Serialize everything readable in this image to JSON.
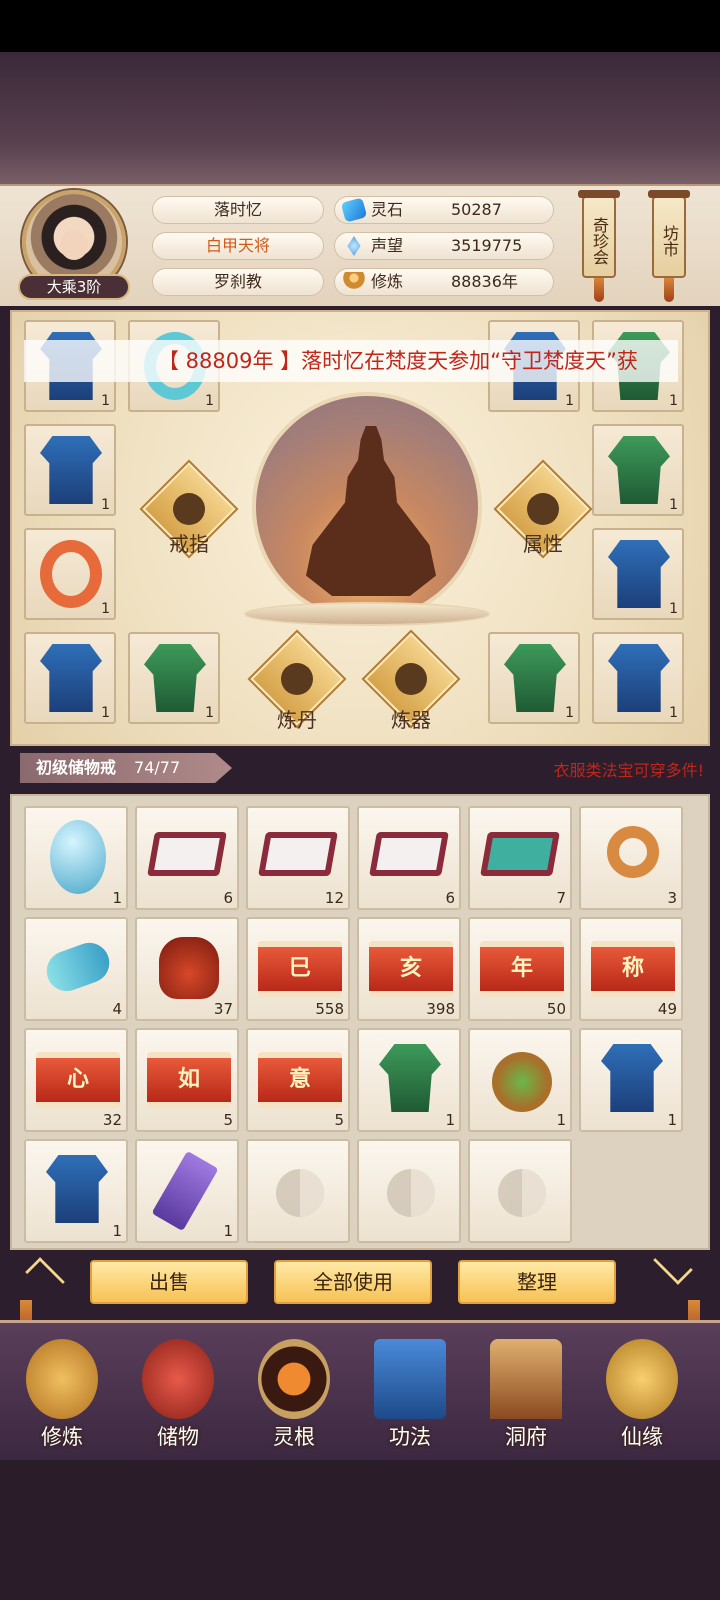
{
  "header": {
    "rank": "大乘3阶",
    "name": "落时忆",
    "title": "白甲天将",
    "sect": "罗刹教",
    "stats": [
      {
        "icon": "spirit-stone-icon",
        "label": "灵石",
        "value": "50287"
      },
      {
        "icon": "reputation-icon",
        "label": "声望",
        "value": "3519775"
      },
      {
        "icon": "cultivation-icon",
        "label": "修炼",
        "value": "88836年"
      }
    ],
    "shops": [
      "奇珍会",
      "坊市"
    ]
  },
  "ticker": "【 88809年 】落时忆在梵度天参加“守卫梵度天”获",
  "equipment": {
    "left_slots": [
      {
        "icon": "blue-armor-icon",
        "count": "1"
      },
      {
        "icon": "jade-bracelet-icon",
        "count": "1"
      },
      {
        "icon": "blue-armor-icon",
        "count": "1"
      },
      {
        "icon": "flower-ring-icon",
        "count": "1"
      },
      {
        "icon": "blue-armor-icon",
        "count": "1"
      },
      {
        "icon": "green-armor-icon",
        "count": "1"
      }
    ],
    "right_slots": [
      {
        "icon": "blue-armor-icon",
        "count": "1"
      },
      {
        "icon": "green-armor-icon",
        "count": "1"
      },
      {
        "icon": "green-armor-icon",
        "count": "1"
      },
      {
        "icon": "blue-armor-icon",
        "count": "1"
      },
      {
        "icon": "green-armor-icon",
        "count": "1"
      },
      {
        "icon": "blue-armor-icon",
        "count": "1"
      }
    ],
    "actions": {
      "ring": "戒指",
      "attributes": "属性",
      "alchemy": "炼丹",
      "forge": "炼器"
    }
  },
  "storage": {
    "name": "初级储物戒",
    "capacity": "74/77",
    "tip": "衣服类法宝可穿多件!",
    "items": [
      {
        "icon": "dragon-egg-icon",
        "count": "1"
      },
      {
        "icon": "white-rice-icon",
        "count": "6"
      },
      {
        "icon": "white-rice-icon",
        "count": "12"
      },
      {
        "icon": "white-rice-icon",
        "count": "6"
      },
      {
        "icon": "jade-leaves-icon",
        "count": "7"
      },
      {
        "icon": "gold-ring-icon",
        "count": "3"
      },
      {
        "icon": "jade-charm-icon",
        "count": "4"
      },
      {
        "icon": "teapot-icon",
        "count": "37"
      },
      {
        "icon": "scroll-icon",
        "glyph": "巳",
        "count": "558"
      },
      {
        "icon": "scroll-icon",
        "glyph": "亥",
        "count": "398"
      },
      {
        "icon": "scroll-icon",
        "glyph": "年",
        "count": "50"
      },
      {
        "icon": "scroll-icon",
        "glyph": "称",
        "count": "49"
      },
      {
        "icon": "scroll-icon",
        "glyph": "心",
        "count": "32"
      },
      {
        "icon": "scroll-icon",
        "glyph": "如",
        "count": "5"
      },
      {
        "icon": "scroll-icon",
        "glyph": "意",
        "count": "5"
      },
      {
        "icon": "green-armor-icon",
        "count": "1"
      },
      {
        "icon": "lucky-bag-icon",
        "count": "1"
      },
      {
        "icon": "blue-armor-icon",
        "count": "1"
      },
      {
        "icon": "blue-armor-icon",
        "count": "1"
      },
      {
        "icon": "purple-token-icon",
        "count": "1"
      }
    ],
    "empty_slots": 3
  },
  "buttons": {
    "sell": "出售",
    "use_all": "全部使用",
    "sort": "整理"
  },
  "nav": [
    {
      "label": "修炼",
      "icon": "cultivate-icon",
      "color": "#e0a030"
    },
    {
      "label": "储物",
      "icon": "storage-bag-icon",
      "color": "#c83a2a"
    },
    {
      "label": "灵根",
      "icon": "spirit-root-icon",
      "color": "#e06020"
    },
    {
      "label": "功法",
      "icon": "technique-book-icon",
      "color": "#3a7ac8"
    },
    {
      "label": "洞府",
      "icon": "cave-house-icon",
      "color": "#c87a3a"
    },
    {
      "label": "仙缘",
      "icon": "immortal-fate-icon",
      "color": "#d8a040"
    }
  ]
}
